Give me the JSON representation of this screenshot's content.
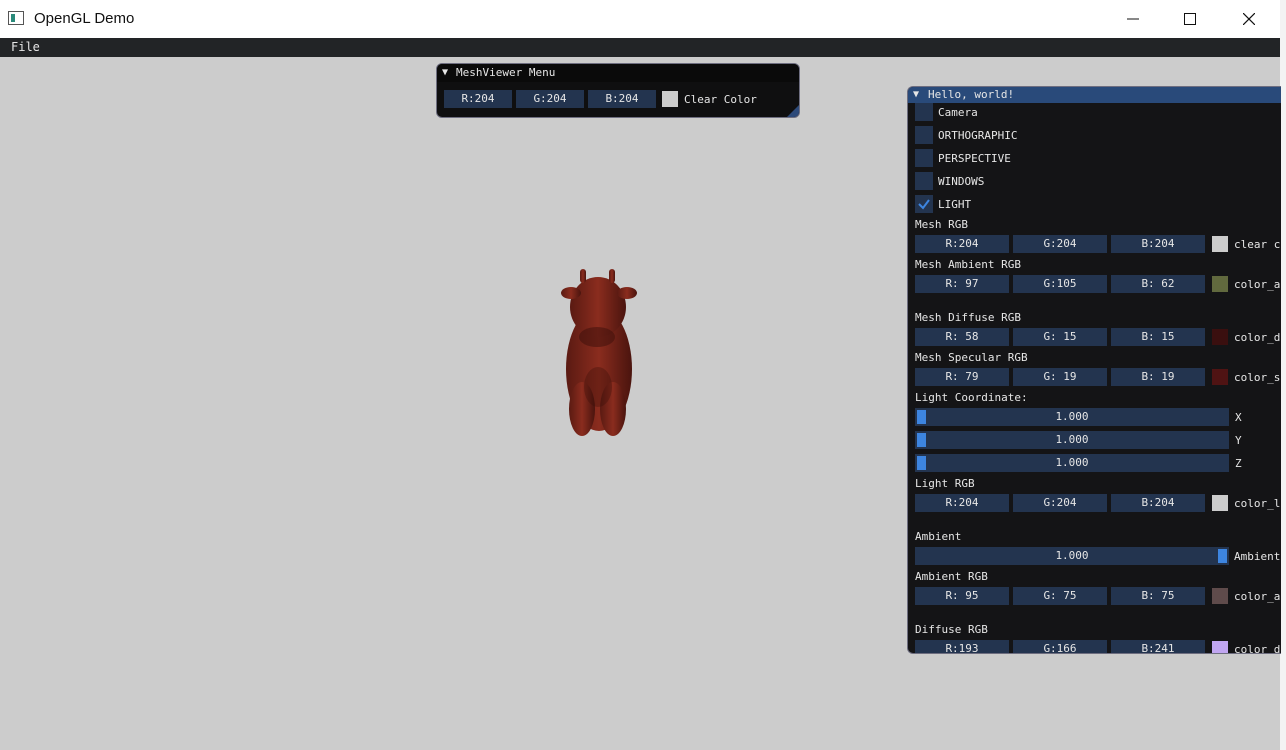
{
  "window": {
    "title": "OpenGL Demo"
  },
  "menubar": {
    "file": "File"
  },
  "meshviewer": {
    "title": "MeshViewer Menu",
    "r": "R:204",
    "g": "G:204",
    "b": "B:204",
    "color_hex": "#cccccc",
    "label": "Clear Color"
  },
  "hello": {
    "title": "Hello, world!",
    "checkboxes": [
      {
        "label": "Camera",
        "checked": false
      },
      {
        "label": "ORTHOGRAPHIC",
        "checked": false
      },
      {
        "label": "PERSPECTIVE",
        "checked": false
      },
      {
        "label": "WINDOWS",
        "checked": false
      },
      {
        "label": "LIGHT",
        "checked": true
      }
    ],
    "mesh_rgb": {
      "label": "Mesh RGB",
      "r": "R:204",
      "g": "G:204",
      "b": "B:204",
      "color_hex": "#cccccc",
      "name": "clear c"
    },
    "mesh_ambient": {
      "label": "Mesh Ambient RGB",
      "r": "R: 97",
      "g": "G:105",
      "b": "B: 62",
      "color_hex": "#61693e",
      "name": "color_a"
    },
    "mesh_diffuse": {
      "label": "Mesh Diffuse RGB",
      "r": "R: 58",
      "g": "G: 15",
      "b": "B: 15",
      "color_hex": "#3a0f0f",
      "name": "color_d"
    },
    "mesh_specular": {
      "label": "Mesh Specular RGB",
      "r": "R: 79",
      "g": "G: 19",
      "b": "B: 19",
      "color_hex": "#4f1313",
      "name": "color_s"
    },
    "light_coord": {
      "label": "Light Coordinate:",
      "x": {
        "value": "1.000",
        "axis": "X",
        "level": 0.0
      },
      "y": {
        "value": "1.000",
        "axis": "Y",
        "level": 0.0
      },
      "z": {
        "value": "1.000",
        "axis": "Z",
        "level": 0.0
      }
    },
    "light_rgb": {
      "label": "Light RGB",
      "r": "R:204",
      "g": "G:204",
      "b": "B:204",
      "color_hex": "#cccccc",
      "name": "color_l"
    },
    "ambient": {
      "label": "Ambient",
      "value": "1.000",
      "name": "Ambient",
      "level": 1.0
    },
    "ambient_rgb": {
      "label": "Ambient RGB",
      "r": "R: 95",
      "g": "G: 75",
      "b": "B: 75",
      "color_hex": "#5f4b4b",
      "name": "color_a"
    },
    "diffuse_rgb": {
      "label": "Diffuse RGB",
      "r": "R:193",
      "g": "G:166",
      "b": "B:241",
      "color_hex": "#c1a6f1",
      "name": "color_d"
    }
  }
}
